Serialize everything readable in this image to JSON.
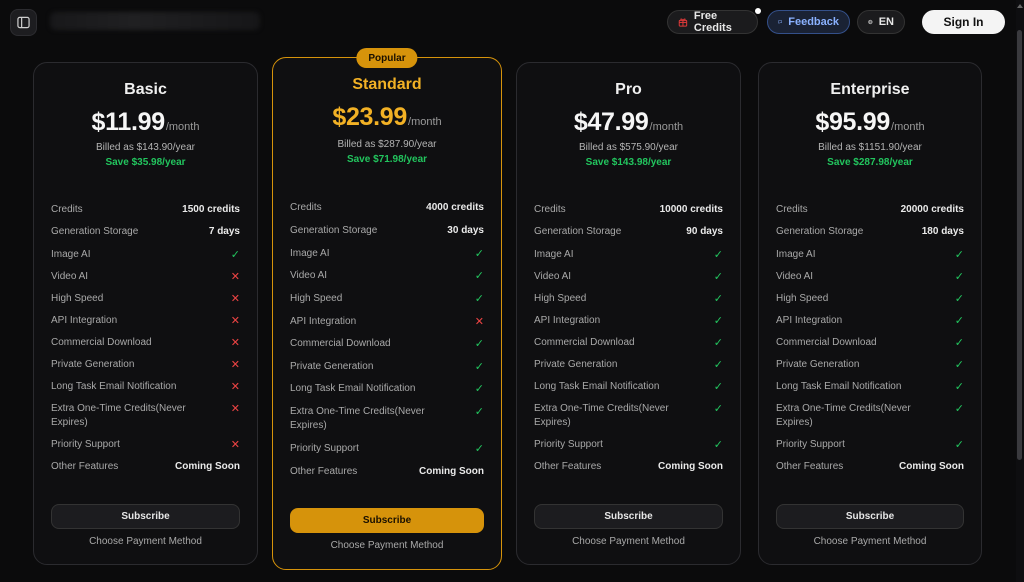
{
  "header": {
    "free_credits_label": "Free Credits",
    "feedback_label": "Feedback",
    "language_label": "EN",
    "signin_label": "Sign In"
  },
  "colors": {
    "accent": "#d6930b",
    "check": "#22c55e",
    "cross": "#ef4444",
    "feedback": "#8ab1ff"
  },
  "icons": {
    "sidebar_toggle": "sidebar-toggle-icon",
    "free_credits": "gift-icon",
    "feedback": "chat-icon",
    "language": "globe-icon",
    "included": "check-icon",
    "excluded": "close-icon"
  },
  "plans": [
    {
      "name": "Basic",
      "price": "$11.99",
      "period": "/month",
      "billed": "Billed as $143.90/year",
      "save": "Save $35.98/year",
      "badge": "",
      "subscribe_label": "Subscribe",
      "payment_label": "Choose Payment Method",
      "features": [
        {
          "label": "Credits",
          "value": "1500 credits"
        },
        {
          "label": "Generation Storage",
          "value": "7 days"
        },
        {
          "label": "Image AI",
          "included": true
        },
        {
          "label": "Video AI",
          "included": false
        },
        {
          "label": "High Speed",
          "included": false
        },
        {
          "label": "API Integration",
          "included": false
        },
        {
          "label": "Commercial Download",
          "included": false
        },
        {
          "label": "Private Generation",
          "included": false
        },
        {
          "label": "Long Task Email Notification",
          "included": false
        },
        {
          "label": "Extra One-Time Credits(Never Expires)",
          "included": false
        },
        {
          "label": "Priority Support",
          "included": false
        },
        {
          "label": "Other Features",
          "value": "Coming Soon"
        }
      ]
    },
    {
      "name": "Standard",
      "price": "$23.99",
      "period": "/month",
      "billed": "Billed as $287.90/year",
      "save": "Save $71.98/year",
      "badge": "Popular",
      "subscribe_label": "Subscribe",
      "payment_label": "Choose Payment Method",
      "features": [
        {
          "label": "Credits",
          "value": "4000 credits"
        },
        {
          "label": "Generation Storage",
          "value": "30 days"
        },
        {
          "label": "Image AI",
          "included": true
        },
        {
          "label": "Video AI",
          "included": true
        },
        {
          "label": "High Speed",
          "included": true
        },
        {
          "label": "API Integration",
          "included": false
        },
        {
          "label": "Commercial Download",
          "included": true
        },
        {
          "label": "Private Generation",
          "included": true
        },
        {
          "label": "Long Task Email Notification",
          "included": true
        },
        {
          "label": "Extra One-Time Credits(Never Expires)",
          "included": true
        },
        {
          "label": "Priority Support",
          "included": true
        },
        {
          "label": "Other Features",
          "value": "Coming Soon"
        }
      ]
    },
    {
      "name": "Pro",
      "price": "$47.99",
      "period": "/month",
      "billed": "Billed as $575.90/year",
      "save": "Save $143.98/year",
      "badge": "",
      "subscribe_label": "Subscribe",
      "payment_label": "Choose Payment Method",
      "features": [
        {
          "label": "Credits",
          "value": "10000 credits"
        },
        {
          "label": "Generation Storage",
          "value": "90 days"
        },
        {
          "label": "Image AI",
          "included": true
        },
        {
          "label": "Video AI",
          "included": true
        },
        {
          "label": "High Speed",
          "included": true
        },
        {
          "label": "API Integration",
          "included": true
        },
        {
          "label": "Commercial Download",
          "included": true
        },
        {
          "label": "Private Generation",
          "included": true
        },
        {
          "label": "Long Task Email Notification",
          "included": true
        },
        {
          "label": "Extra One-Time Credits(Never Expires)",
          "included": true
        },
        {
          "label": "Priority Support",
          "included": true
        },
        {
          "label": "Other Features",
          "value": "Coming Soon"
        }
      ]
    },
    {
      "name": "Enterprise",
      "price": "$95.99",
      "period": "/month",
      "billed": "Billed as $1151.90/year",
      "save": "Save $287.98/year",
      "badge": "",
      "subscribe_label": "Subscribe",
      "payment_label": "Choose Payment Method",
      "features": [
        {
          "label": "Credits",
          "value": "20000 credits"
        },
        {
          "label": "Generation Storage",
          "value": "180 days"
        },
        {
          "label": "Image AI",
          "included": true
        },
        {
          "label": "Video AI",
          "included": true
        },
        {
          "label": "High Speed",
          "included": true
        },
        {
          "label": "API Integration",
          "included": true
        },
        {
          "label": "Commercial Download",
          "included": true
        },
        {
          "label": "Private Generation",
          "included": true
        },
        {
          "label": "Long Task Email Notification",
          "included": true
        },
        {
          "label": "Extra One-Time Credits(Never Expires)",
          "included": true
        },
        {
          "label": "Priority Support",
          "included": true
        },
        {
          "label": "Other Features",
          "value": "Coming Soon"
        }
      ]
    }
  ]
}
